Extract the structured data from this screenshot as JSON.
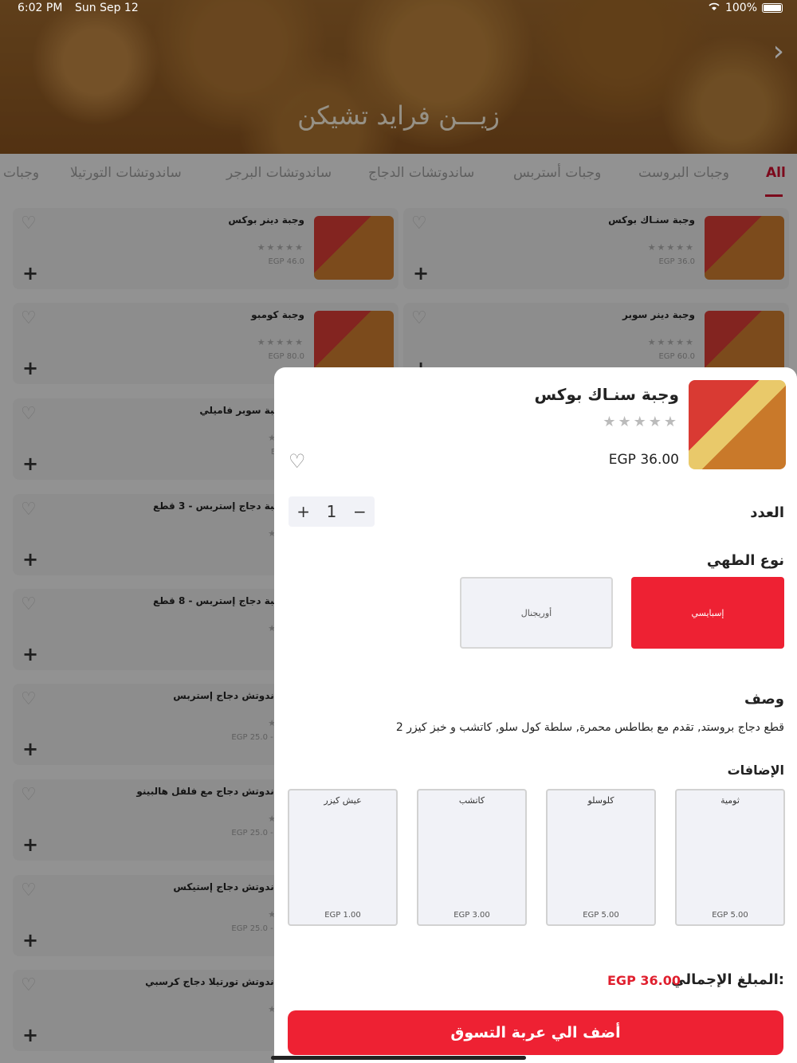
{
  "status_bar": {
    "time": "6:02 PM",
    "date": "Sun Sep 12",
    "battery": "100%"
  },
  "hero": {
    "restaurant_name": "زيـــن فرايد تشيكن",
    "next_icon": "chevron-right-icon"
  },
  "tabs": [
    "All",
    "وجبات البروست",
    "وجبات أستربس",
    "ساندوتشات الدجاج",
    "ساندوتشات البرجر",
    "ساندوتشات التورتيلا",
    "وجبات"
  ],
  "cards_right": [
    {
      "name": "وجبة سنـاك بوكس",
      "price": "EGP 36.0"
    },
    {
      "name": "وجبة دينر سوبر",
      "price": "EGP 60.0"
    }
  ],
  "cards_left": [
    {
      "name": "وجبة دينر بوكس",
      "price": "EGP 46.0"
    },
    {
      "name": "وجبة كومبو",
      "price": "EGP 80.0"
    },
    {
      "name": "وجبة سوبر فاميلي",
      "price": "EGP"
    },
    {
      "name": "وجبة دجاج إستربس - 3 قطع",
      "price": "EG"
    },
    {
      "name": "وجبة دجاج إستربس - 8 قطع",
      "price": "EG"
    },
    {
      "name": "ساندوتش دجاج إستربس",
      "price": "EGP 25.0 - EG"
    },
    {
      "name": "ساندوتش دجاج مع فلفل هالبينو",
      "price": "EGP 25.0 - EG"
    },
    {
      "name": "ساندوتش دجاج إستيكس",
      "price": "EGP 25.0 - EG"
    },
    {
      "name": "ساندوتش تورتيلا دجاج كرسبي",
      "price": "EG"
    }
  ],
  "modal": {
    "name": "وجبة سنـاك بوكس",
    "price": "EGP 36.00",
    "quantity": "1",
    "quantity_label": "العدد",
    "cooking_label": "نوع الطهي",
    "cooking_options": [
      "إسبايسي",
      "أوريجنال"
    ],
    "selected_cooking": "إسبايسي",
    "description_label": "وصف",
    "description": "2 قطع دجاج بروستد, تقدم مع بطاطس محمرة, سلطة كول سلو, كاتشب و خبز كيزر",
    "addons_label": "الإضافات",
    "addons": [
      {
        "name": "ثومية",
        "price": "EGP 5.00"
      },
      {
        "name": "كلوسلو",
        "price": "EGP 5.00"
      },
      {
        "name": "كاتشب",
        "price": "EGP 3.00"
      },
      {
        "name": "عيش كيزر",
        "price": "EGP 1.00"
      }
    ],
    "total_label": "المبلغ الإجمالي:",
    "total_value": "EGP 36.00",
    "add_to_cart": "أضف الي عربة التسوق"
  },
  "colors": {
    "accent": "#ee2133",
    "tab_active": "#c8102e",
    "total_price": "#e01f2e"
  }
}
